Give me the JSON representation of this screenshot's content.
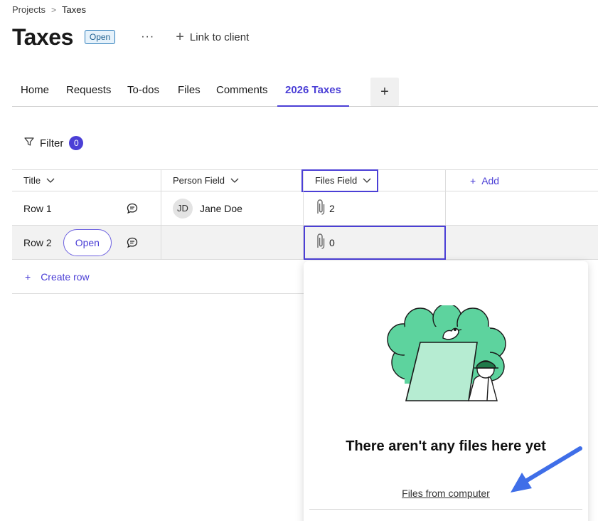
{
  "breadcrumb": {
    "root": "Projects",
    "separator": ">",
    "current": "Taxes"
  },
  "header": {
    "title": "Taxes",
    "status": "Open",
    "more_label": "···",
    "link_client_label": "Link to client"
  },
  "tabs": [
    {
      "label": "Home"
    },
    {
      "label": "Requests"
    },
    {
      "label": "To-dos"
    },
    {
      "label": "Files"
    },
    {
      "label": "Comments"
    },
    {
      "label": "2026 Taxes",
      "active": true
    }
  ],
  "filter": {
    "label": "Filter",
    "count": "0"
  },
  "table": {
    "columns": [
      {
        "label": "Title"
      },
      {
        "label": "Person Field"
      },
      {
        "label": "Files Field"
      }
    ],
    "add_column_label": "Add",
    "rows": [
      {
        "title": "Row 1",
        "person_initials": "JD",
        "person_name": "Jane Doe",
        "files_count": "2"
      },
      {
        "title": "Row 2",
        "open_label": "Open",
        "person_initials": "",
        "person_name": "",
        "files_count": "0"
      }
    ],
    "create_row_label": "Create row"
  },
  "popover": {
    "empty_title": "There aren't any files here yet",
    "upload_link": "Files from computer"
  },
  "colors": {
    "accent": "#4b3fd6",
    "illustration_green": "#5dd39e",
    "illustration_light": "#b6ecd2",
    "arrow": "#3f6ee8"
  }
}
